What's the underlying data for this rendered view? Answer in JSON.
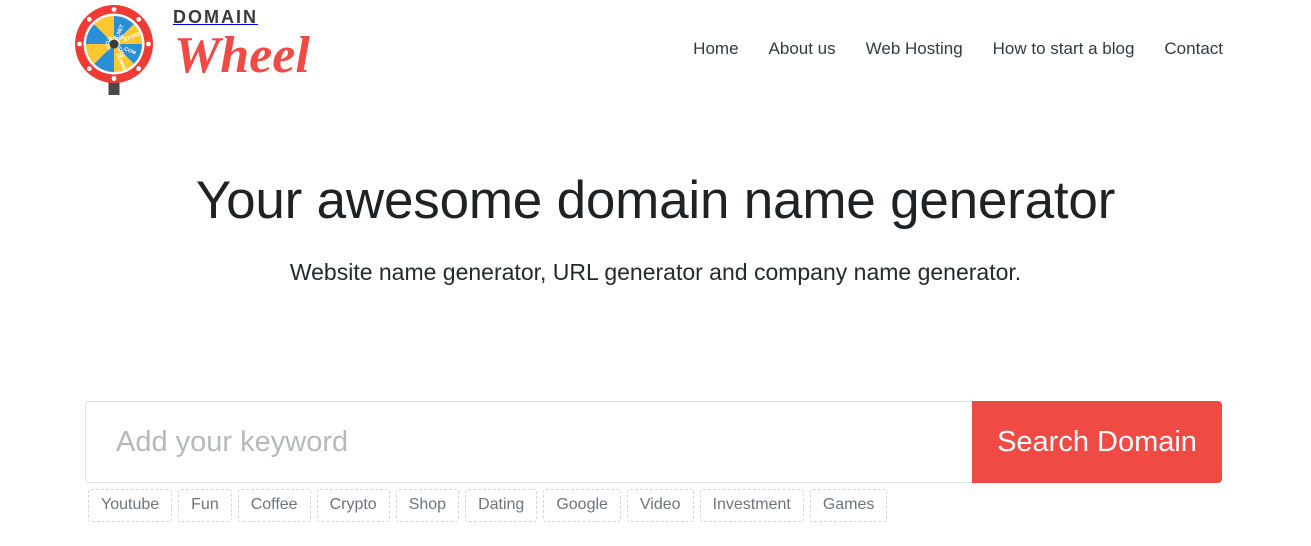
{
  "brand": {
    "logo_icon": "domain-wheel-logo",
    "top_word": "DOMAIN",
    "script_word": "Wheel",
    "colors": {
      "ring_red": "#ee3b33",
      "segment_blue": "#2b8fd6",
      "segment_yellow": "#fdc82f",
      "pointer_gray": "#4a4a4a",
      "script_red": "#ef4a44"
    },
    "wheel_segments": [
      ".NET",
      ".STORE",
      ".COM",
      ".SUMMIT",
      ".CI",
      ".ONLINE",
      ".INFO",
      ".WEBSITE"
    ]
  },
  "nav": {
    "items": [
      {
        "label": "Home"
      },
      {
        "label": "About us"
      },
      {
        "label": "Web Hosting"
      },
      {
        "label": "How to start a blog"
      },
      {
        "label": "Contact"
      }
    ]
  },
  "hero": {
    "title": "Your awesome domain name generator",
    "subtitle": "Website name generator, URL generator and company name generator."
  },
  "search": {
    "placeholder": "Add your keyword",
    "value": "",
    "button_label": "Search Domain",
    "button_color": "#ef4a44"
  },
  "tags": [
    {
      "label": "Youtube"
    },
    {
      "label": "Fun"
    },
    {
      "label": "Coffee"
    },
    {
      "label": "Crypto"
    },
    {
      "label": "Shop"
    },
    {
      "label": "Dating"
    },
    {
      "label": "Google"
    },
    {
      "label": "Video"
    },
    {
      "label": "Investment"
    },
    {
      "label": "Games"
    }
  ]
}
